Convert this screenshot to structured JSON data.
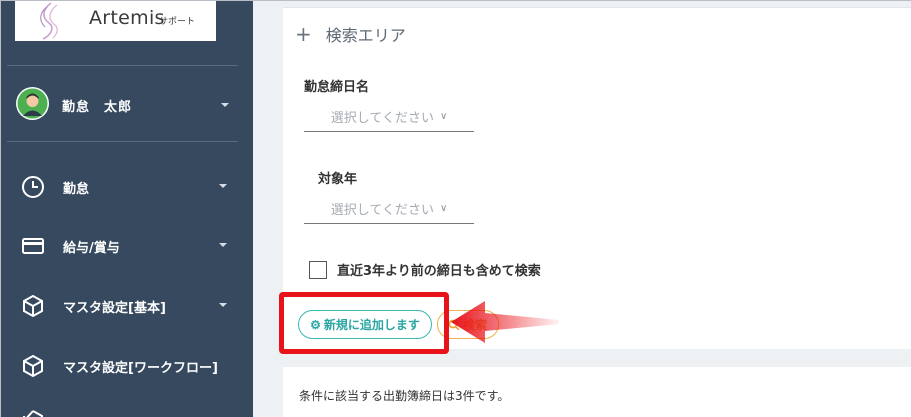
{
  "brand": {
    "name": "Artemis",
    "sub": "サポート"
  },
  "user": {
    "name": "勤怠　太郎"
  },
  "nav": [
    {
      "label": "勤怠",
      "icon": "clock-icon"
    },
    {
      "label": "給与/賞与",
      "icon": "card-icon"
    },
    {
      "label": "マスタ設定[基本]",
      "icon": "cube-icon"
    },
    {
      "label": "マスタ設定[ワークフロー]",
      "icon": "cube-icon"
    }
  ],
  "search": {
    "header": "検索エリア",
    "closing_label": "勤怠締日名",
    "closing_placeholder": "選択してください",
    "year_label": "対象年",
    "year_placeholder": "選択してください",
    "checkbox_label": "直近3年より前の締日も含めて検索",
    "add_button": "新規に追加します",
    "search_button": "検索"
  },
  "result": {
    "text": "条件に該当する出勤簿締日は3件です。"
  },
  "colors": {
    "sidebar": "#36495f",
    "accent_teal": "#3ab7b3",
    "accent_orange": "#f0b24a",
    "highlight_red": "#e8121a"
  }
}
